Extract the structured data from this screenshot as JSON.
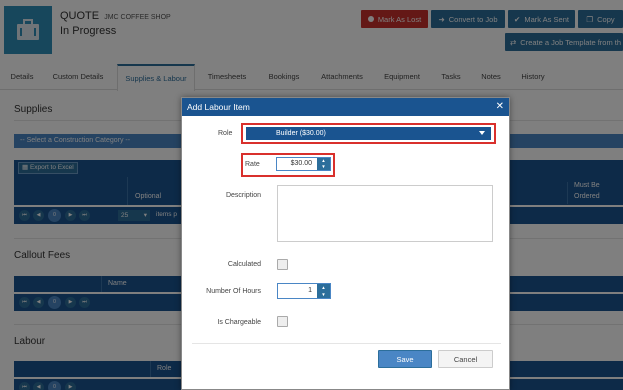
{
  "header": {
    "doc_type": "QUOTE",
    "customer": "JMC COFFEE SHOP",
    "status": "In Progress",
    "logo_icon": "briefcase-icon"
  },
  "actions": {
    "mark_lost": "Mark As Lost",
    "convert_job": "Convert to Job",
    "mark_sent": "Mark As Sent",
    "copy": "Copy",
    "create_template": "Create a Job Template from th"
  },
  "tabs": [
    {
      "label": "Details"
    },
    {
      "label": "Custom Details"
    },
    {
      "label": "Supplies & Labour"
    },
    {
      "label": "Timesheets"
    },
    {
      "label": "Bookings"
    },
    {
      "label": "Attachments"
    },
    {
      "label": "Equipment"
    },
    {
      "label": "Tasks"
    },
    {
      "label": "Notes"
    },
    {
      "label": "History"
    }
  ],
  "supplies": {
    "title": "Supplies",
    "category_placeholder": "-- Select a Construction Category --",
    "export_label": "Export to Excel",
    "col_optional": "Optional",
    "col_must_be": "Must Be",
    "col_ordered": "Ordered",
    "page": "0",
    "page_size": "25",
    "items_per_page": "items p"
  },
  "callout": {
    "title": "Callout Fees",
    "col_name": "Name",
    "page": "0"
  },
  "labour": {
    "title": "Labour",
    "col_role": "Role",
    "page": "0"
  },
  "modal": {
    "title": "Add Labour Item",
    "role_label": "Role",
    "role_value": "Builder ($30.00)",
    "rate_label": "Rate",
    "rate_value": "$30.00",
    "description_label": "Description",
    "calculated_label": "Calculated",
    "hours_label": "Number Of Hours",
    "hours_value": "1",
    "chargeable_label": "Is Chargeable",
    "save": "Save",
    "cancel": "Cancel"
  },
  "colors": {
    "primary": "#1a5490",
    "accent": "#2c6e9b",
    "danger": "#c9302c",
    "highlight": "#d9302c"
  }
}
